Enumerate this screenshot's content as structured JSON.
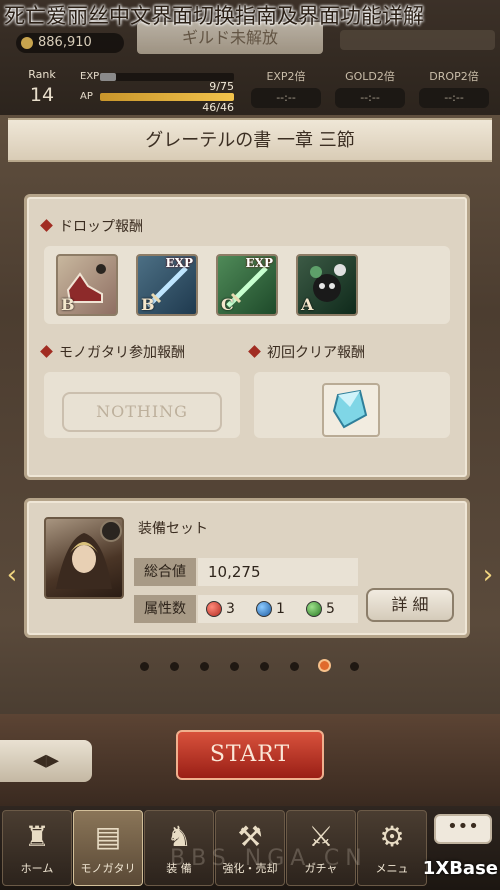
{
  "article_title": "死亡爱丽丝中文界面切换指南及界面功能详解",
  "header": {
    "coins": "886,910",
    "banner": "ギルド未解放",
    "rank_label": "Rank",
    "rank_value": "14",
    "exp_label": "EXP",
    "exp_value": "9/75",
    "exp_fraction": 0.12,
    "ap_label": "AP",
    "ap_value": "46/46",
    "ap_fraction": 1.0,
    "boosts": [
      {
        "label": "EXP2倍",
        "value": "--:--"
      },
      {
        "label": "GOLD2倍",
        "value": "--:--"
      },
      {
        "label": "DROP2倍",
        "value": "--:--"
      }
    ]
  },
  "chapter_title": "グレーテルの書 一章 三節",
  "rewards": {
    "drop_title": "ドロップ報酬",
    "items": [
      {
        "rank": "B",
        "badge": "",
        "icon": "red-shoes-icon"
      },
      {
        "rank": "B",
        "badge": "EXP",
        "icon": "blue-sword-icon"
      },
      {
        "rank": "C",
        "badge": "EXP",
        "icon": "green-sword-icon"
      },
      {
        "rank": "A",
        "badge": "",
        "icon": "dark-creature-icon"
      }
    ],
    "story_title": "モノガタリ参加報酬",
    "story_value": "NOTHING",
    "first_clear_title": "初回クリア報酬"
  },
  "equip": {
    "title": "装備セット",
    "total_label": "総合値",
    "total_value": "10,275",
    "attr_label": "属性数",
    "attr_red": "3",
    "attr_blue": "1",
    "attr_green": "5",
    "detail_button": "詳 細"
  },
  "pager": {
    "count": 8,
    "active_index": 6
  },
  "actions": {
    "start": "START",
    "back_icon": "◂▸"
  },
  "nav": [
    {
      "label": "ホーム",
      "icon": "castle-icon"
    },
    {
      "label": "モノガタリ",
      "icon": "book-icon"
    },
    {
      "label": "装 備",
      "icon": "armor-icon"
    },
    {
      "label": "強化・売却",
      "icon": "hammer-icon"
    },
    {
      "label": "ガチャ",
      "icon": "swords-icon"
    },
    {
      "label": "メニュ",
      "icon": "gear-icon"
    }
  ],
  "more_button": "•••",
  "watermark": "BBS.NGA.CN",
  "corner_logo": "1XBase"
}
